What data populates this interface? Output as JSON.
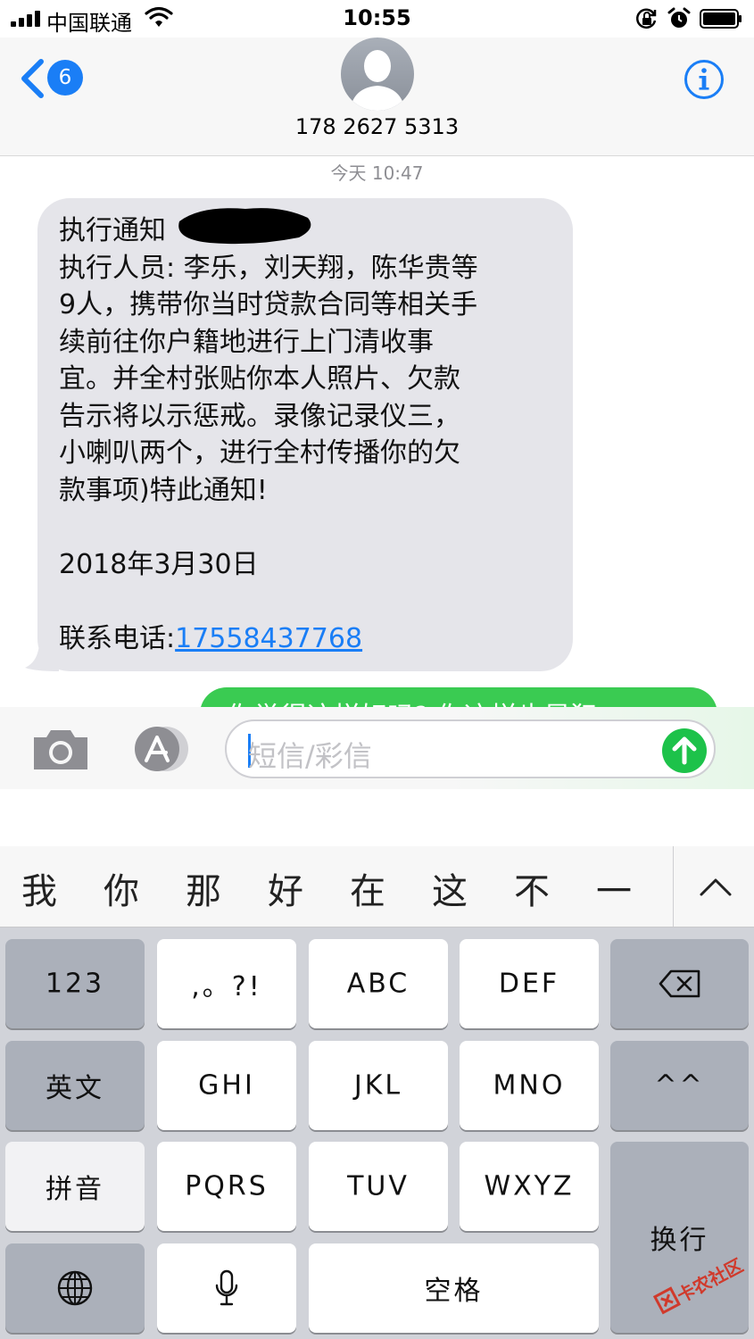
{
  "status_bar": {
    "carrier": "中国联通",
    "time": "10:55",
    "icons": [
      "signal-icon",
      "wifi-icon",
      "orientation-lock-icon",
      "alarm-icon",
      "battery-icon"
    ]
  },
  "header": {
    "back_count": "6",
    "contact_number": "178 2627 5313",
    "icons": [
      "back-chevron-icon",
      "avatar-silhouette-icon",
      "info-icon"
    ]
  },
  "conversation": {
    "timestamp": "今天 10:47",
    "received_lines": [
      "执行通知",
      "执行人员: 李乐，刘天翔，陈华贵等",
      "9人，携带你当时贷款合同等相关手",
      "续前往你户籍地进行上门清收事",
      "宜。并全村张贴你本人照片、欠款",
      "告示将以示惩戒。录像记录仪三，",
      "小喇叭两个，进行全村传播你的欠",
      "款事项)特此通知!"
    ],
    "received_date": "2018年3月30日",
    "contact_label": "联系电话:",
    "contact_link": "17558437768",
    "sent_preview": "你觉得这样好吗?   你这样也是犯"
  },
  "input_bar": {
    "placeholder": "短信/彩信",
    "icons": [
      "camera-icon",
      "app-store-icon",
      "send-arrow-icon"
    ]
  },
  "candidates": [
    "我",
    "你",
    "那",
    "好",
    "在",
    "这",
    "不",
    "一"
  ],
  "keyboard": {
    "row1": [
      "123",
      ",。?!",
      "ABC",
      "DEF"
    ],
    "row2": [
      "英文",
      "GHI",
      "JKL",
      "MNO",
      "^^"
    ],
    "row3": [
      "拼音",
      "PQRS",
      "TUV",
      "WXYZ"
    ],
    "space": "空格",
    "return": "换行",
    "icons": [
      "delete-icon",
      "globe-icon",
      "microphone-icon",
      "collapse-chevron-icon"
    ]
  },
  "watermark": "卡农社区",
  "colors": {
    "accent_blue": "#1a7ef6",
    "sent_green": "#3acb52",
    "received_gray": "#e5e5ea",
    "keyboard_bg": "#d1d3d9"
  }
}
